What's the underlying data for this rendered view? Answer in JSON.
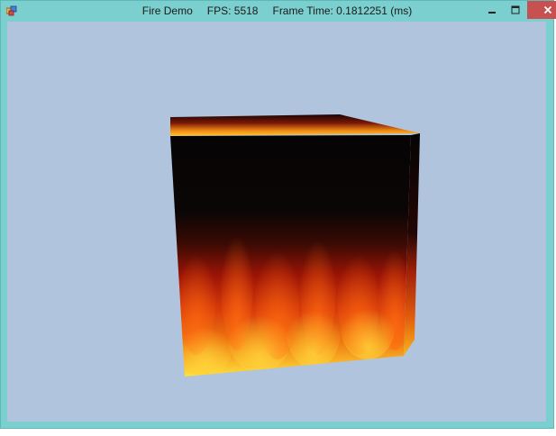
{
  "window": {
    "title": "Fire Demo",
    "fps": "FPS: 5518",
    "frame_time": "Frame Time: 0.1812251 (ms)",
    "controls": {
      "minimize_icon": "minimize-icon",
      "maximize_icon": "maximize-icon",
      "close_icon": "close-icon"
    }
  },
  "viewport": {
    "background_color": "#b0c4de",
    "scene_object": "fire-textured-cube"
  }
}
